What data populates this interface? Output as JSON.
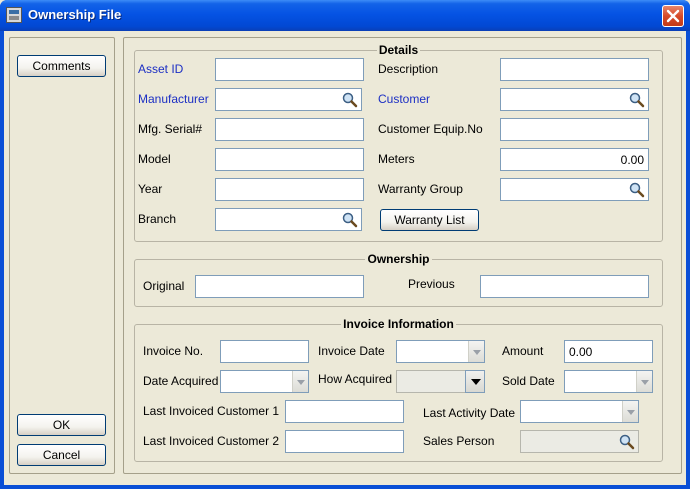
{
  "window": {
    "title": "Ownership File"
  },
  "left": {
    "comments_label": "Comments",
    "ok_label": "OK",
    "cancel_label": "Cancel"
  },
  "details": {
    "title": "Details",
    "asset_id": "Asset ID",
    "manufacturer": "Manufacturer",
    "mfg_serial": "Mfg. Serial#",
    "model": "Model",
    "year": "Year",
    "branch": "Branch",
    "description": "Description",
    "customer": "Customer",
    "customer_equip": "Customer Equip.No",
    "meters": "Meters",
    "meters_value": "0.00",
    "warranty_group": "Warranty Group",
    "warranty_list": "Warranty List"
  },
  "ownership": {
    "title": "Ownership",
    "original": "Original",
    "previous": "Previous"
  },
  "invoice": {
    "title": "Invoice Information",
    "invoice_no": "Invoice No.",
    "invoice_date": "Invoice Date",
    "amount": "Amount",
    "amount_value": "0.00",
    "date_acquired": "Date Acquired",
    "how_acquired": "How Acquired",
    "sold_date": "Sold Date",
    "last_inv_cust1": "Last Invoiced Customer 1",
    "last_activity_date": "Last Activity Date",
    "last_inv_cust2": "Last Invoiced Customer 2",
    "sales_person": "Sales Person"
  },
  "colors": {
    "title_blue": "#0553e4",
    "label_blue": "#1c2fc4",
    "field_border": "#7f9db9"
  }
}
